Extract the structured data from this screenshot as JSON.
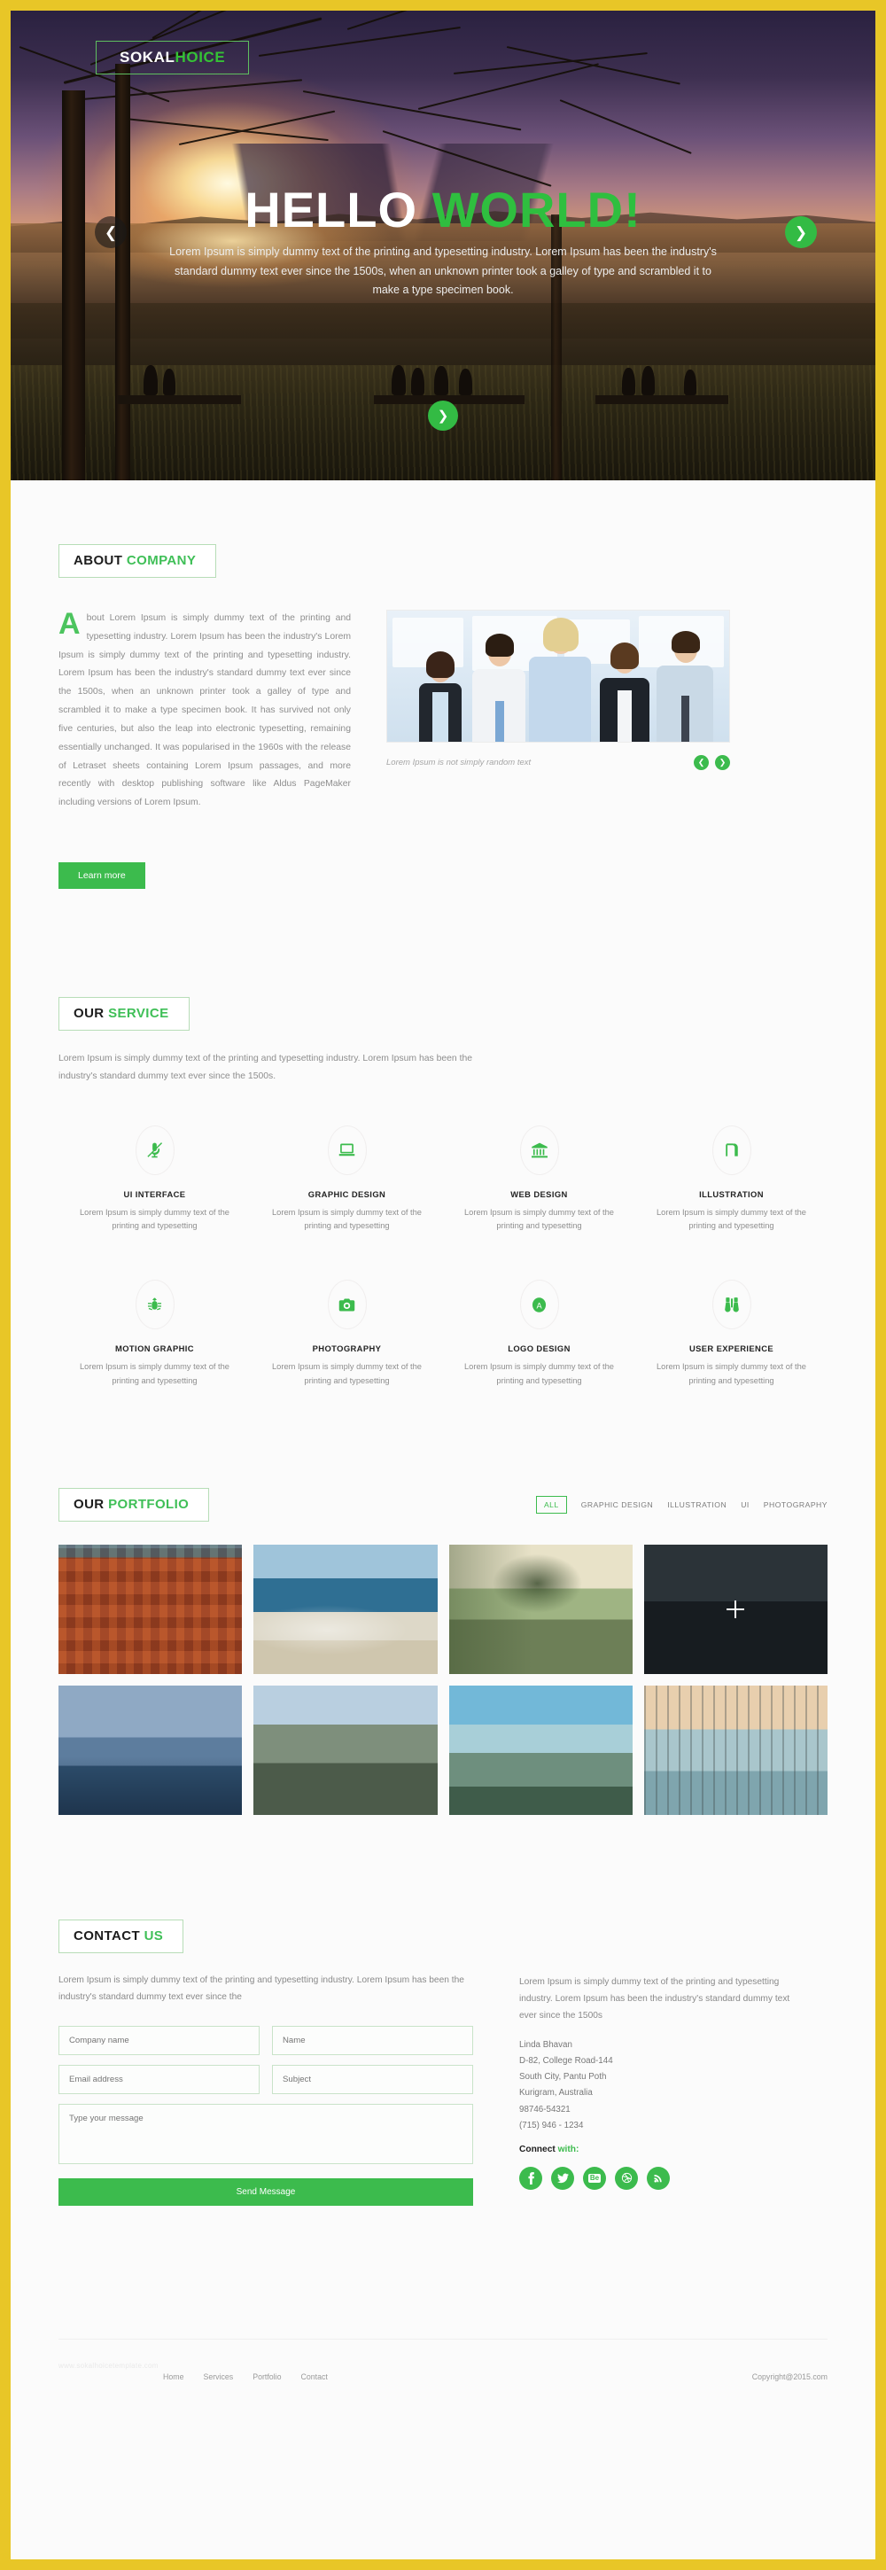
{
  "brand": {
    "name_white": "SOKAL",
    "name_green": "HOICE"
  },
  "hero": {
    "title_white": "HELLO ",
    "title_green": "WORLD!",
    "subtitle": "Lorem Ipsum is simply dummy text of the printing and typesetting industry. Lorem Ipsum has been the industry's standard dummy text ever since the 1500s, when an unknown printer took a galley of type and scrambled it to make a type specimen book.",
    "prev_icon": "chevron-left",
    "next_icon": "chevron-right",
    "scroll_icon": "chevron-down",
    "accent": "#33bb44"
  },
  "about": {
    "title_a": "ABOUT ",
    "title_b": "COMPANY",
    "dropcap": "A",
    "paragraph": "bout Lorem Ipsum is simply dummy text of the printing and typesetting industry. Lorem Ipsum has been the industry's Lorem Ipsum is simply dummy text of the printing and typesetting industry. Lorem Ipsum has been the industry's standard dummy text ever since the 1500s, when an unknown printer took a galley of type and scrambled it to make a type specimen book. It has survived not only five centuries, but also the leap into electronic typesetting, remaining essentially unchanged. It was popularised in the 1960s with the release of Letraset sheets containing Lorem Ipsum passages, and more recently with desktop publishing software like Aldus PageMaker including versions of Lorem Ipsum.",
    "caption": "Lorem Ipsum is not simply random text",
    "prev_icon": "chevron-left",
    "next_icon": "chevron-right",
    "learn_more": "Learn more"
  },
  "service": {
    "title_a": "OUR ",
    "title_b": "SERVICE",
    "description": "Lorem Ipsum is simply dummy text of the printing and typesetting industry. Lorem Ipsum has been the industry's standard dummy text ever since the 1500s.",
    "items": [
      {
        "icon": "microphone-slash-icon",
        "name": "UI INTERFACE",
        "desc": "Lorem Ipsum is simply dummy text of the printing and typesetting"
      },
      {
        "icon": "laptop-icon",
        "name": "GRAPHIC DESIGN",
        "desc": "Lorem Ipsum is simply dummy text of the printing and typesetting"
      },
      {
        "icon": "bank-icon",
        "name": "WEB DESIGN",
        "desc": "Lorem Ipsum is simply dummy text of the printing and typesetting"
      },
      {
        "icon": "shekel-icon",
        "name": "ILLUSTRATION",
        "desc": "Lorem Ipsum is simply dummy text of the printing and typesetting"
      },
      {
        "icon": "bug-icon",
        "name": "MOTION GRAPHIC",
        "desc": "Lorem Ipsum is simply dummy text of the printing and typesetting"
      },
      {
        "icon": "camera-icon",
        "name": "PHOTOGRAPHY",
        "desc": "Lorem Ipsum is simply dummy text of the printing and typesetting"
      },
      {
        "icon": "circle-a-icon",
        "name": "LOGO DESIGN",
        "desc": "Lorem Ipsum is simply dummy text of the printing and typesetting"
      },
      {
        "icon": "binoculars-icon",
        "name": "USER EXPERIENCE",
        "desc": "Lorem Ipsum is simply dummy text of the printing and typesetting"
      }
    ]
  },
  "portfolio": {
    "title_a": "OUR ",
    "title_b": "PORTFOLIO",
    "filters": [
      "ALL",
      "GRAPHIC DESIGN",
      "ILLUSTRATION",
      "UI",
      "PHOTOGRAPHY"
    ],
    "active_filter": "ALL",
    "items": [
      {
        "name": "colorful-hillside-village"
      },
      {
        "name": "coastal-cliff-sea"
      },
      {
        "name": "pine-tree-cliff"
      },
      {
        "name": "dark-mountain-silhouette"
      },
      {
        "name": "lake-pier-dusk"
      },
      {
        "name": "hikers-on-ridge"
      },
      {
        "name": "misty-mountain-lake"
      },
      {
        "name": "long-wooden-pier"
      }
    ]
  },
  "contact": {
    "title_a": "CONTACT ",
    "title_b": "US",
    "intro": "Lorem Ipsum is simply dummy text of the printing and typesetting industry. Lorem Ipsum has been the industry's standard dummy text ever since the",
    "form": {
      "company_placeholder": "Company name",
      "name_placeholder": "Name",
      "email_placeholder": "Email address",
      "subject_placeholder": "Subject",
      "message_placeholder": "Type your message",
      "submit_label": "Send Message",
      "company_value": "",
      "name_value": "",
      "email_value": "",
      "subject_value": "",
      "message_value": ""
    },
    "lead": "Lorem Ipsum is simply dummy text of the printing and typesetting industry. Lorem Ipsum has been the industry's standard dummy text ever since the 1500s",
    "address": [
      "Linda Bhavan",
      "D-82, College Road-144",
      "South City, Pantu Poth",
      "Kurigram,  Australia",
      "98746-54321",
      "(715) 946 - 1234"
    ],
    "connect_a": "Connect ",
    "connect_b": "with:",
    "socials": [
      {
        "icon": "facebook-icon",
        "glyph": "f"
      },
      {
        "icon": "twitter-icon",
        "glyph": "ᵀ"
      },
      {
        "icon": "behance-icon",
        "glyph": "Be"
      },
      {
        "icon": "dribbble-icon",
        "glyph": "◌"
      },
      {
        "icon": "rss-icon",
        "glyph": "ᴿ"
      }
    ]
  },
  "footer": {
    "logo_text": "www.sokalhoicetemplate.com",
    "nav": [
      "Home",
      "Services",
      "Portfolio",
      "Contact"
    ],
    "copyright": "Copyright@2015.com"
  }
}
